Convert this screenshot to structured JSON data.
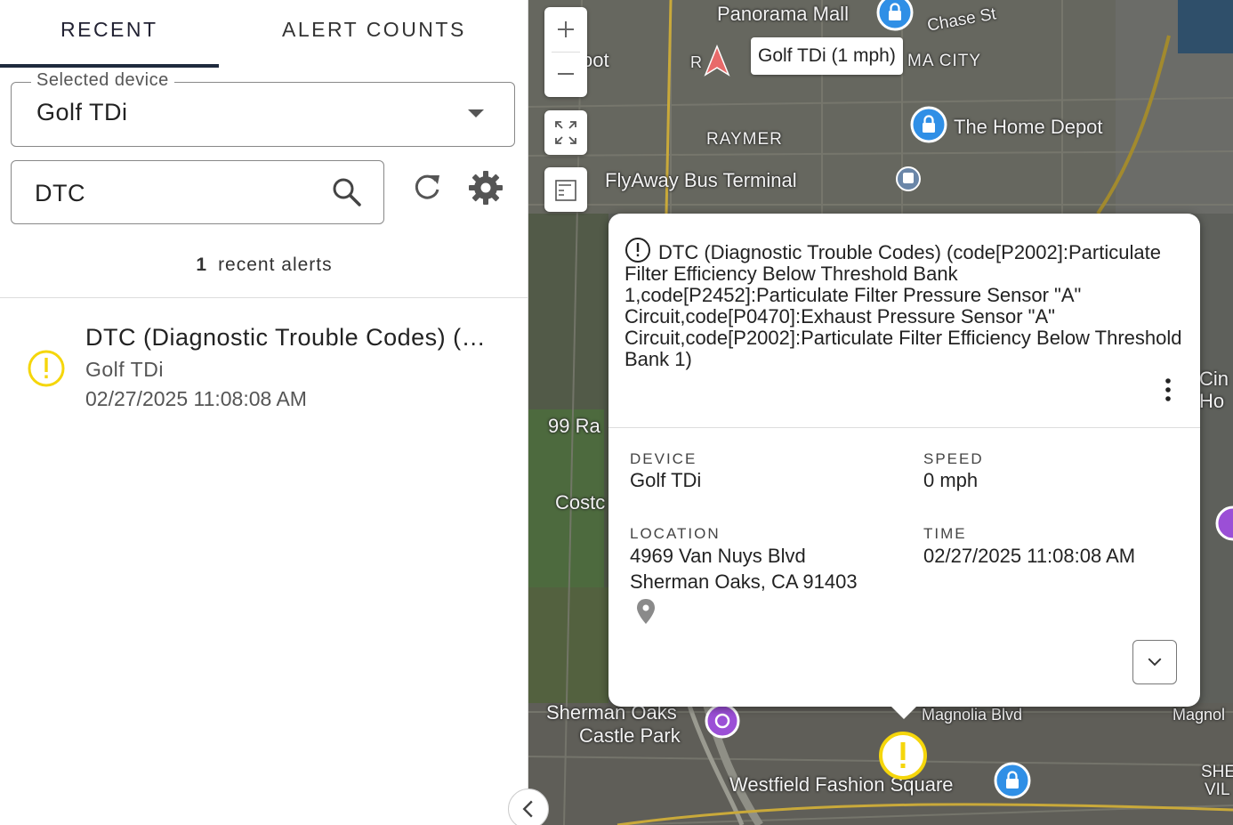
{
  "tabs": {
    "recent": "RECENT",
    "alert_counts": "ALERT COUNTS"
  },
  "device_select": {
    "legend": "Selected device",
    "value": "Golf TDi"
  },
  "search": {
    "value": "DTC"
  },
  "summary": {
    "count": "1",
    "label": "recent alerts"
  },
  "alerts": [
    {
      "title": "DTC (Diagnostic Trouble Codes) (…",
      "device": "Golf TDi",
      "time": "02/27/2025 11:08:08 AM"
    }
  ],
  "map": {
    "device_label": "Golf TDi (1 mph)",
    "labels": {
      "panorama": "Panorama Mall",
      "chase": "Chase St",
      "macity": "MA CITY",
      "home_depot": "The Home Depot",
      "raymer": "RAYMER",
      "flyaway": "FlyAway Bus Terminal",
      "sherman_oaks": "Sherman Oaks",
      "castle_park": "Castle Park",
      "magnolia": "Magnolia Blvd",
      "magnolia2": "Magnol",
      "westfield": "Westfield Fashion Square",
      "r99": "99 Ra",
      "costco": "Costc",
      "ro": "R",
      "oot": "oot",
      "she": "SHE",
      "vil": "VIL",
      "cin": "Cin",
      "ho": "Ho"
    }
  },
  "popup": {
    "title": "DTC (Diagnostic Trouble Codes) (code[P2002]:Particulate Filter Efficiency Below Threshold Bank 1,code[P2452]:Particulate Filter Pressure Sensor \"A\" Circuit,code[P0470]:Exhaust Pressure Sensor \"A\" Circuit,code[P2002]:Particulate Filter Efficiency Below Threshold Bank 1)",
    "device_label": "DEVICE",
    "device_value": "Golf TDi",
    "speed_label": "SPEED",
    "speed_value": "0 mph",
    "location_label": "LOCATION",
    "location_line1": "4969 Van Nuys Blvd",
    "location_line2": "Sherman Oaks, CA 91403",
    "time_label": "TIME",
    "time_value": "02/27/2025 11:08:08 AM"
  },
  "colors": {
    "warning": "#f5d60b",
    "tab_indicator": "#1f2a3d",
    "pin_blue": "#2f8fe6",
    "pin_purple": "#9b4fd6"
  }
}
